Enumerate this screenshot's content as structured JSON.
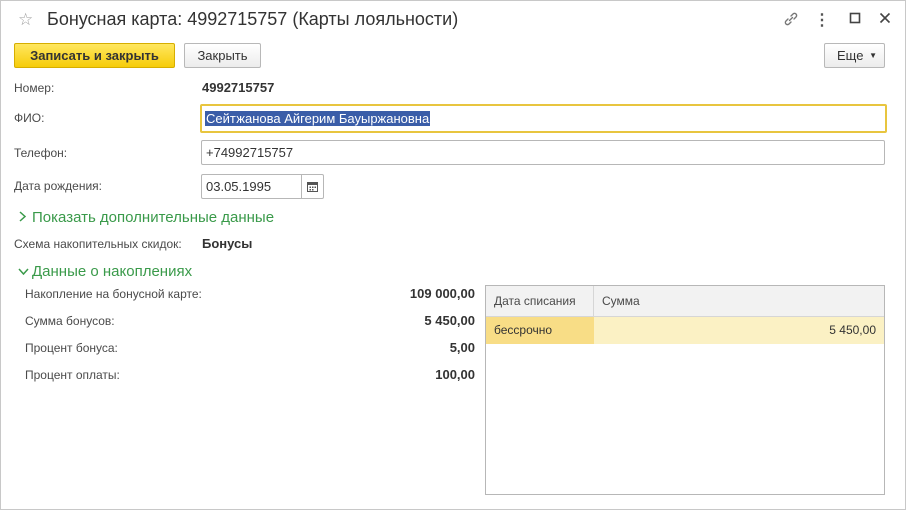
{
  "window": {
    "title": "Бонусная карта: 4992715757 (Карты лояльности)",
    "icons": [
      "star-icon",
      "link-icon",
      "more-icon",
      "maximize-icon",
      "close-icon"
    ]
  },
  "toolbar": {
    "save_close_label": "Записать и закрыть",
    "close_label": "Закрыть",
    "more_label": "Еще"
  },
  "form": {
    "number_label": "Номер:",
    "number_value": "4992715757",
    "fio_label": "ФИО:",
    "fio_value": "Сейтжанова Айгерим Бауыржановна",
    "phone_label": "Телефон:",
    "phone_value": "+74992715757",
    "birth_label": "Дата рождения:",
    "birth_value": "03.05.1995",
    "extra_link": "Показать дополнительные данные",
    "scheme_label": "Схема накопительных скидок:",
    "scheme_value": "Бонусы",
    "accum_group": "Данные о накоплениях"
  },
  "accumulation": {
    "rows": [
      {
        "label": "Накопление на бонусной карте:",
        "value": "109 000,00"
      },
      {
        "label": "Сумма бонусов:",
        "value": "5 450,00"
      },
      {
        "label": "Процент бонуса:",
        "value": "5,00"
      },
      {
        "label": "Процент оплаты:",
        "value": "100,00"
      }
    ]
  },
  "table": {
    "columns": [
      "Дата списания",
      "Сумма"
    ],
    "rows": [
      {
        "date": "бессрочно",
        "sum": "5 450,00"
      }
    ]
  },
  "colors": {
    "accent_yellow": "#f6cc0a",
    "link_green": "#3a9a4a",
    "selection_blue": "#3a5da8",
    "row_highlight": "#fbf1c4"
  }
}
